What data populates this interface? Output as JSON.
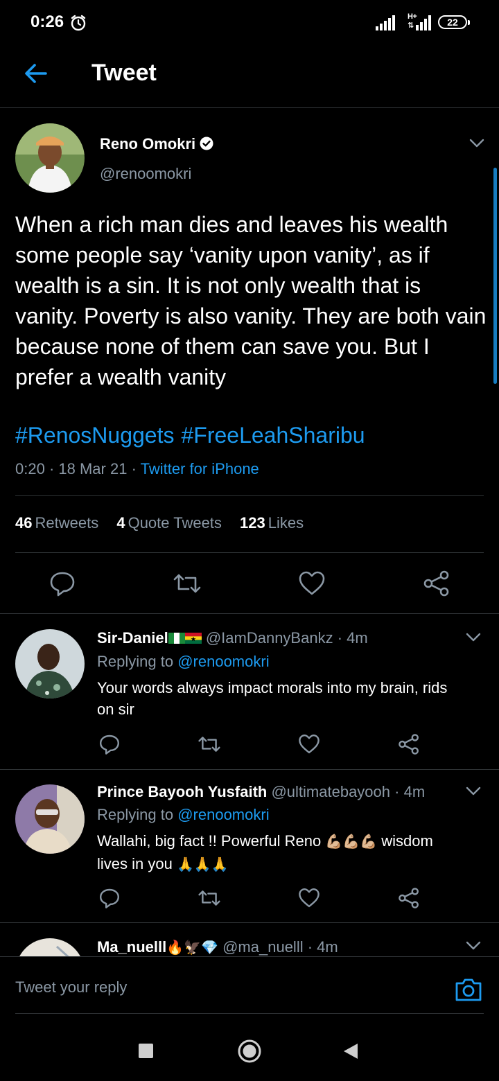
{
  "status_bar": {
    "time": "0:26",
    "battery": "22"
  },
  "header": {
    "title": "Tweet"
  },
  "tweet": {
    "author_name": "Reno Omokri",
    "author_handle": "@renoomokri",
    "text": "When a rich man dies and leaves his wealth some people say ‘vanity upon vanity’, as if wealth is a sin. It is not only wealth that is vanity. Poverty is also vanity. They are both vain because none of them can save you. But I prefer a wealth vanity",
    "hashtags": [
      "#RenosNuggets",
      "#FreeLeahSharibu"
    ],
    "time": "0:20",
    "date": "18 Mar 21",
    "source": "Twitter for iPhone",
    "retweets_count": "46",
    "retweets_label": "Retweets",
    "quotes_count": "4",
    "quotes_label": "Quote Tweets",
    "likes_count": "123",
    "likes_label": "Likes"
  },
  "replies": [
    {
      "name": "Sir-Daniel",
      "handle": "@IamDannyBankz",
      "age": "4m",
      "replying_label": "Replying to",
      "replying_to": "@renoomokri",
      "text_line1": "Your words always impact morals into my brain, rids",
      "text_line2": "on sir"
    },
    {
      "name": "Prince Bayooh Yusfaith",
      "handle": "@ultimatebayooh",
      "age": "4m",
      "replying_label": "Replying to",
      "replying_to": "@renoomokri",
      "text_line1a": "Wallahi, big fact !! Powerful Reno",
      "text_line1_emoji": "💪🏼💪🏼💪🏼",
      "text_line1b": "wisdom",
      "text_line2": "lives in you",
      "text_line2_emoji": "🙏🙏🙏"
    },
    {
      "name": "Ma_nuelll",
      "name_emoji": "🔥🦅💎",
      "handle": "@ma_nuelll",
      "age": "4m"
    }
  ],
  "compose": {
    "placeholder": "Tweet your reply"
  },
  "colors": {
    "accent": "#1d9bf0",
    "background": "#000000",
    "muted": "#8b98a5",
    "divider": "#2f3336"
  },
  "icons": [
    "back-arrow-icon",
    "verified-icon",
    "chevron-down-icon",
    "reply-icon",
    "retweet-icon",
    "like-icon",
    "share-icon",
    "camera-icon",
    "alarm-icon",
    "signal-icon",
    "battery-icon"
  ]
}
